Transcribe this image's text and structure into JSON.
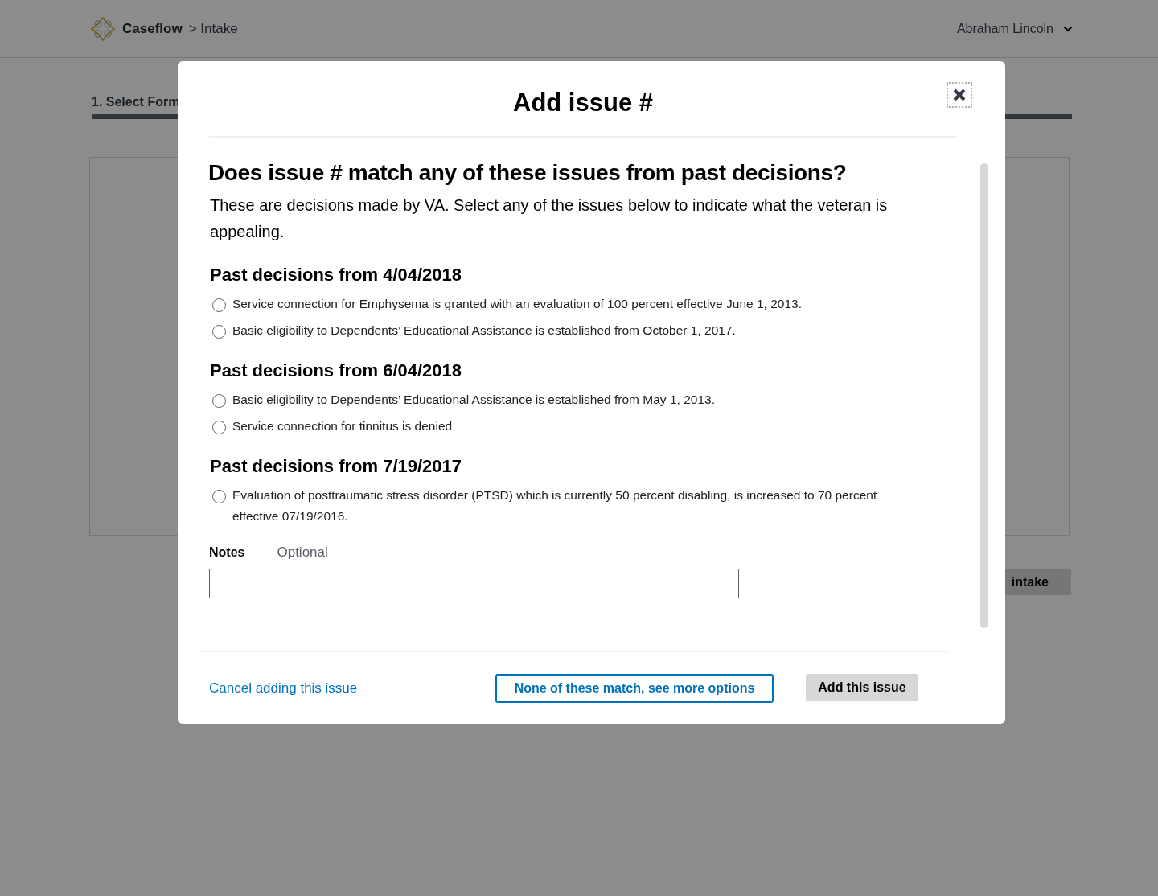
{
  "header": {
    "app_name": "Caseflow",
    "breadcrumb": "> Intake",
    "user": "Abraham Lincoln"
  },
  "steps": [
    {
      "label": "1. Select Form",
      "selected": true
    }
  ],
  "background_button": {
    "label": "intake"
  },
  "modal": {
    "title": "Add issue #",
    "question": "Does issue # match any of these issues from past decisions?",
    "intro": "These are decisions made by VA. Select any of the issues below to indicate what the veteran is appealing.",
    "sections": [
      {
        "heading": "Past decisions from 4/04/2018",
        "issues": [
          {
            "text": "Service connection for Emphysema is granted with an evaluation of 100 percent effective June 1, 2013.",
            "selected": false
          },
          {
            "text": "Basic eligibility to Dependents’ Educational Assistance is established from October 1, 2017.",
            "selected": false
          }
        ]
      },
      {
        "heading": "Past decisions from 6/04/2018",
        "issues": [
          {
            "text": "Basic eligibility to Dependents’ Educational Assistance is established from May 1, 2013.",
            "selected": false
          },
          {
            "text": "Service connection for tinnitus is denied.",
            "selected": false
          }
        ]
      },
      {
        "heading": "Past decisions from 7/19/2017",
        "issues": [
          {
            "text": "Evaluation of posttraumatic stress disorder (PTSD) which is currently 50 percent disabling, is increased to 70 percent effective 07/19/2016.",
            "selected": false
          }
        ]
      }
    ],
    "notes": {
      "label": "Notes",
      "hint": "Optional"
    },
    "cancel_link": "Cancel adding this issue",
    "secondary_button": "None of these match, see more options",
    "primary_button": "Add this issue"
  }
}
